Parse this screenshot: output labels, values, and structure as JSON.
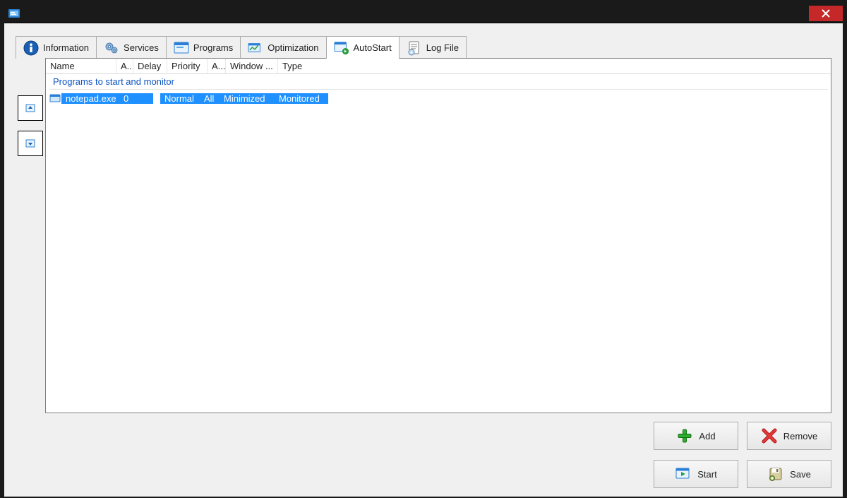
{
  "window": {
    "close_tooltip": "Close"
  },
  "tabs": {
    "information": "Information",
    "services": "Services",
    "programs": "Programs",
    "optimization": "Optimization",
    "autostart": "AutoStart",
    "logfile": "Log File"
  },
  "columns": {
    "name": "Name",
    "arg": "A...",
    "delay": "Delay",
    "priority": "Priority",
    "aff": "A...",
    "window": "Window ...",
    "type": "Type"
  },
  "group_header": "Programs to start and monitor",
  "rows": [
    {
      "name": "notepad.exe",
      "arg": "",
      "delay": "0",
      "priority": "Normal",
      "aff": "All",
      "window": "Minimized",
      "type": "Monitored",
      "selected": true
    }
  ],
  "buttons": {
    "add": "Add",
    "remove": "Remove",
    "start": "Start",
    "save": "Save"
  }
}
